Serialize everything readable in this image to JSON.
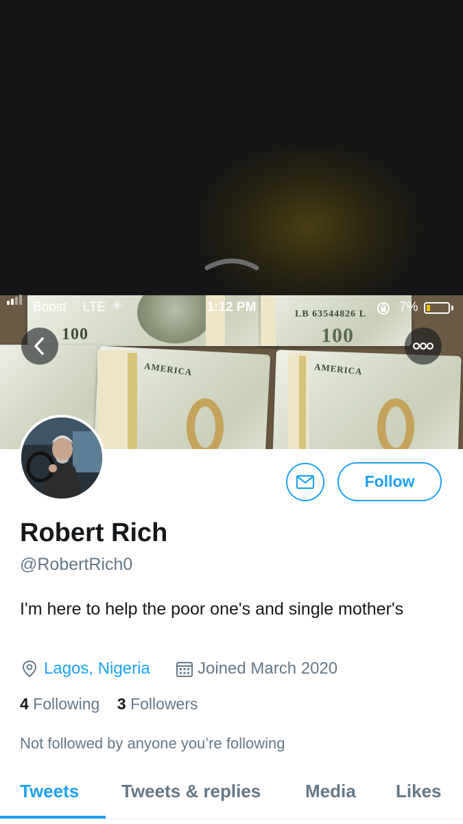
{
  "status_bar": {
    "carrier": "Boost",
    "network": "LTE",
    "time": "1:12 PM",
    "battery": "7%",
    "battery_level": 0.07
  },
  "header": {
    "bill_numbers": [
      "100",
      "100"
    ],
    "bill_serial": "LB 63544826 L",
    "bill_text": "AMERICA"
  },
  "profile": {
    "name": "Robert Rich",
    "handle": "@RobertRich0",
    "bio": "I'm here to help the poor one's and single mother's",
    "location": "Lagos, Nigeria",
    "joined": "Joined March 2020",
    "following_count": "4",
    "following_label": "Following",
    "followers_count": "3",
    "followers_label": "Followers",
    "mutuals": "Not followed by anyone you’re following"
  },
  "actions": {
    "follow_label": "Follow"
  },
  "tabs": [
    {
      "label": "Tweets",
      "active": true
    },
    {
      "label": "Tweets & replies",
      "active": false
    },
    {
      "label": "Media",
      "active": false
    },
    {
      "label": "Likes",
      "active": false
    }
  ],
  "colors": {
    "accent": "#1da1f2",
    "secondary_text": "#657786",
    "primary_text": "#14171a"
  }
}
